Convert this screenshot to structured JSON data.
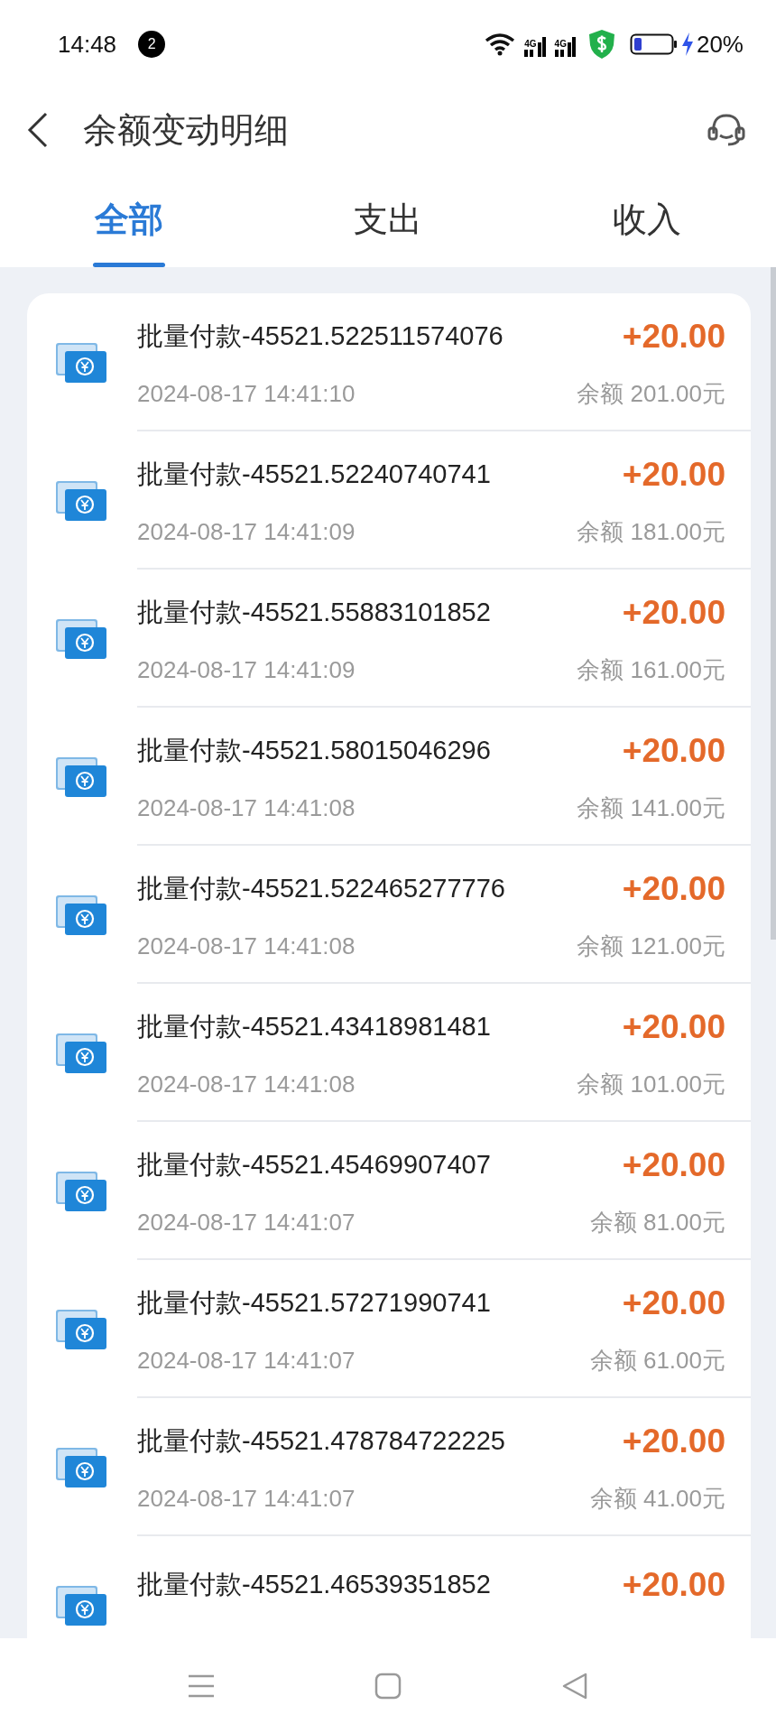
{
  "status_bar": {
    "time": "14:48",
    "notification_count": "2",
    "signals": [
      {
        "label": "4G"
      },
      {
        "label": "4G"
      }
    ],
    "battery_text": "20%"
  },
  "header": {
    "title": "余额变动明细"
  },
  "tabs": [
    {
      "label": "全部",
      "selected": true
    },
    {
      "label": "支出",
      "selected": false
    },
    {
      "label": "收入",
      "selected": false
    }
  ],
  "transactions": [
    {
      "title": "批量付款-45521.522511574076",
      "time": "2024-08-17 14:41:10",
      "amount": "+20.00",
      "balance": "余额 201.00元"
    },
    {
      "title": "批量付款-45521.52240740741",
      "time": "2024-08-17 14:41:09",
      "amount": "+20.00",
      "balance": "余额 181.00元"
    },
    {
      "title": "批量付款-45521.55883101852",
      "time": "2024-08-17 14:41:09",
      "amount": "+20.00",
      "balance": "余额 161.00元"
    },
    {
      "title": "批量付款-45521.58015046296",
      "time": "2024-08-17 14:41:08",
      "amount": "+20.00",
      "balance": "余额 141.00元"
    },
    {
      "title": "批量付款-45521.522465277776",
      "time": "2024-08-17 14:41:08",
      "amount": "+20.00",
      "balance": "余额 121.00元"
    },
    {
      "title": "批量付款-45521.43418981481",
      "time": "2024-08-17 14:41:08",
      "amount": "+20.00",
      "balance": "余额 101.00元"
    },
    {
      "title": "批量付款-45521.45469907407",
      "time": "2024-08-17 14:41:07",
      "amount": "+20.00",
      "balance": "余额 81.00元"
    },
    {
      "title": "批量付款-45521.57271990741",
      "time": "2024-08-17 14:41:07",
      "amount": "+20.00",
      "balance": "余额 61.00元"
    },
    {
      "title": "批量付款-45521.478784722225",
      "time": "2024-08-17 14:41:07",
      "amount": "+20.00",
      "balance": "余额 41.00元"
    },
    {
      "title": "批量付款-45521.46539351852",
      "amount": "+20.00"
    }
  ]
}
